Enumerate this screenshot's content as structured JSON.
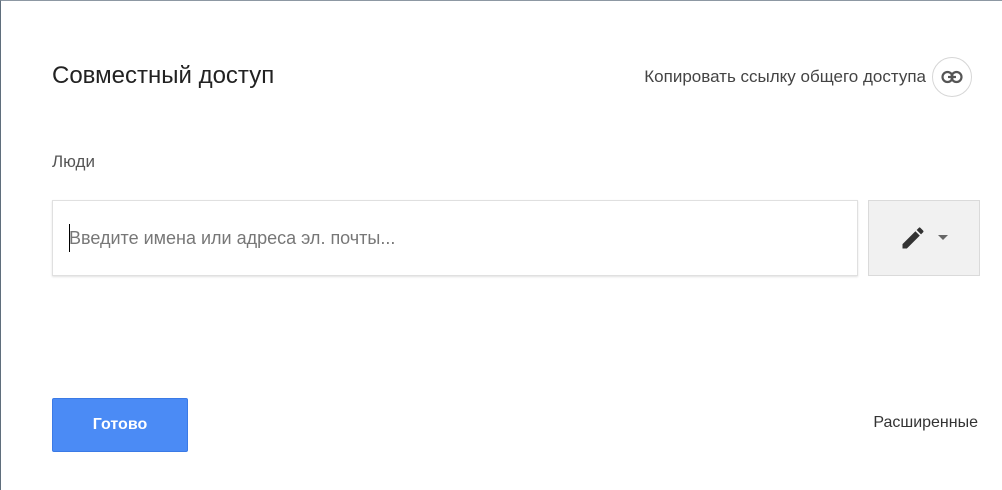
{
  "dialog": {
    "title": "Совместный доступ",
    "copy_link_label": "Копировать ссылку общего доступа",
    "copy_link_icon": "link-icon",
    "people_label": "Люди",
    "people_input": {
      "value": "",
      "placeholder": "Введите имена или адреса эл. почты..."
    },
    "permission_button": {
      "icon": "pencil-icon",
      "dropdown_icon": "caret-down-icon"
    },
    "done_label": "Готово",
    "advanced_label": "Расширенные"
  },
  "colors": {
    "accent": "#4b8bf5",
    "text": "#222222",
    "muted": "#555555"
  }
}
